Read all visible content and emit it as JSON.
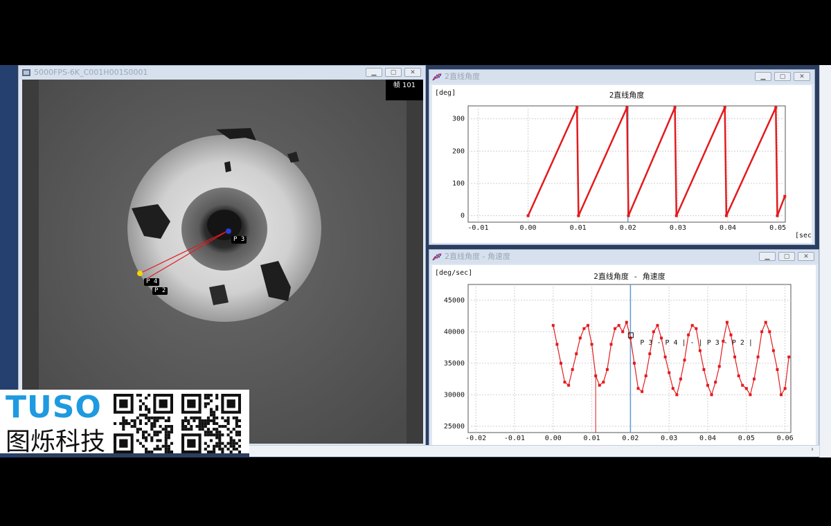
{
  "video_window": {
    "title": "5000FPS-6K_C001H001S0001",
    "frame_label": "帧 101",
    "points": [
      "P 3",
      "P 4",
      "P 2"
    ]
  },
  "chart1_window": {
    "title": "2直线角度",
    "unit": "[deg]",
    "xunit": "[sec]"
  },
  "chart2_window": {
    "title": "2直线角度 - 角速度",
    "unit": "[deg/sec]",
    "annotation": "P 3 - P 4 | - | P 3 - P 2 |"
  },
  "logo": {
    "brand": "TUSO",
    "chinese": "图烁科技"
  },
  "colors": {
    "series": "#e31a1c",
    "cursor": "#5b9bd5",
    "brand": "#1e9ae0"
  },
  "chart_data": [
    {
      "type": "line",
      "title": "2直线角度",
      "ylabel": "[deg]",
      "xlabel": "[sec]",
      "xlim": [
        -0.012,
        0.0515
      ],
      "ylim": [
        -20,
        340
      ],
      "xticks": [
        -0.01,
        0.0,
        0.01,
        0.02,
        0.03,
        0.04,
        0.05
      ],
      "xtick_labels": [
        "-0.01",
        "0.00",
        "0.01",
        "0.02",
        "0.03",
        "0.04",
        "0.05"
      ],
      "yticks": [
        0,
        100,
        200,
        300
      ],
      "ytick_labels": [
        "0",
        "100",
        "200",
        "300"
      ],
      "cursor_x": 0.02,
      "series": [
        {
          "x": [
            0.0,
            0.0098,
            0.0101,
            0.0198,
            0.0201,
            0.0294,
            0.0297,
            0.0394,
            0.0397,
            0.0496,
            0.0499,
            0.0514
          ],
          "values": [
            0,
            335,
            0,
            335,
            0,
            335,
            0,
            335,
            0,
            335,
            0,
            60
          ]
        }
      ]
    },
    {
      "type": "line",
      "title": "2直线角度 - 角速度",
      "ylabel": "[deg/sec]",
      "xlim": [
        -0.022,
        0.0615
      ],
      "ylim": [
        24000,
        47500
      ],
      "xticks": [
        -0.02,
        -0.01,
        0.0,
        0.01,
        0.02,
        0.03,
        0.04,
        0.05,
        0.06
      ],
      "xtick_labels": [
        "-0.02",
        "-0.01",
        "0.00",
        "0.01",
        "0.02",
        "0.03",
        "0.04",
        "0.05",
        "0.06"
      ],
      "yticks": [
        25000,
        30000,
        35000,
        40000,
        45000
      ],
      "ytick_labels": [
        "25000",
        "30000",
        "35000",
        "40000",
        "45000"
      ],
      "cursor_x": 0.02,
      "series": [
        {
          "x": [
            0.0,
            0.001,
            0.002,
            0.003,
            0.004,
            0.005,
            0.006,
            0.007,
            0.008,
            0.009,
            0.01,
            0.011,
            0.012,
            0.013,
            0.014,
            0.015,
            0.016,
            0.017,
            0.018,
            0.019,
            0.02,
            0.021,
            0.022,
            0.023,
            0.024,
            0.025,
            0.026,
            0.027,
            0.028,
            0.029,
            0.03,
            0.031,
            0.032,
            0.033,
            0.034,
            0.035,
            0.036,
            0.037,
            0.038,
            0.039,
            0.04,
            0.041,
            0.042,
            0.043,
            0.044,
            0.045,
            0.046,
            0.047,
            0.048,
            0.049,
            0.05,
            0.051,
            0.052,
            0.053,
            0.054,
            0.055,
            0.056,
            0.057,
            0.058,
            0.059,
            0.06,
            0.061
          ],
          "values": [
            41000,
            38000,
            35000,
            32000,
            31500,
            34000,
            36500,
            39000,
            40500,
            41000,
            38000,
            33000,
            31500,
            32000,
            34000,
            38000,
            40500,
            41000,
            40000,
            41500,
            39000,
            35000,
            31000,
            30500,
            33000,
            36500,
            40000,
            41000,
            39000,
            36000,
            33500,
            31000,
            30000,
            32500,
            35500,
            39500,
            41000,
            40500,
            37000,
            34000,
            31500,
            30000,
            32000,
            34500,
            38500,
            41500,
            39500,
            36000,
            33000,
            31500,
            31000,
            30000,
            32500,
            36000,
            40000,
            41500,
            40000,
            37000,
            34000,
            30000,
            31000,
            36000
          ]
        }
      ]
    }
  ]
}
